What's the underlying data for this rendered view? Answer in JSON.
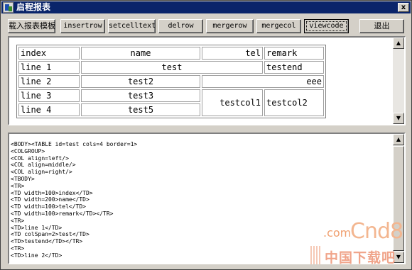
{
  "window": {
    "title": "启程报表",
    "close": "x"
  },
  "toolbar": {
    "buttons": [
      {
        "label": "载入报表模板"
      },
      {
        "label": "insertrow"
      },
      {
        "label": "setcelltext"
      },
      {
        "label": "delrow"
      },
      {
        "label": "mergerow"
      },
      {
        "label": "mergecol"
      },
      {
        "label": "viewcode"
      },
      {
        "label": "退出"
      }
    ]
  },
  "report_table": {
    "header": {
      "index": "index",
      "name": "name",
      "tel": "tel",
      "remark": "remark"
    },
    "row1": {
      "index": "line 1",
      "merged": "test",
      "remark": "testend"
    },
    "row2": {
      "index": "line 2",
      "name": "test2",
      "merged": "eee"
    },
    "row3": {
      "index": "line 3",
      "name": "test3",
      "merged_tel": "testcol1",
      "merged_remark": "testcol2"
    },
    "row4": {
      "index": "line 4",
      "name": "test5"
    }
  },
  "code_view": {
    "lines": [
      "<BODY><TABLE id=test cols=4 border=1>",
      "<COLGROUP>",
      "<COL align=left/>",
      "<COL align=middle/>",
      "<COL align=right/>",
      "<TBODY>",
      "<TR>",
      "<TD width=100>index</TD>",
      "<TD width=200>name</TD>",
      "<TD width=100>tel</TD>",
      "<TD width=100>remark</TD></TR>",
      "<TR>",
      "<TD>line 1</TD>",
      "<TD colSpan=2>test</TD>",
      "<TD>testend</TD></TR>",
      "<TR>",
      "<TD>line 2</TD>"
    ]
  },
  "watermark": {
    "dotcom": ".com",
    "brand": "Cnd8",
    "sub": "中国下载吧"
  },
  "icons": {
    "scroll_up": "up-arrow-icon",
    "scroll_down": "down-arrow-icon",
    "app": "app-icon"
  }
}
